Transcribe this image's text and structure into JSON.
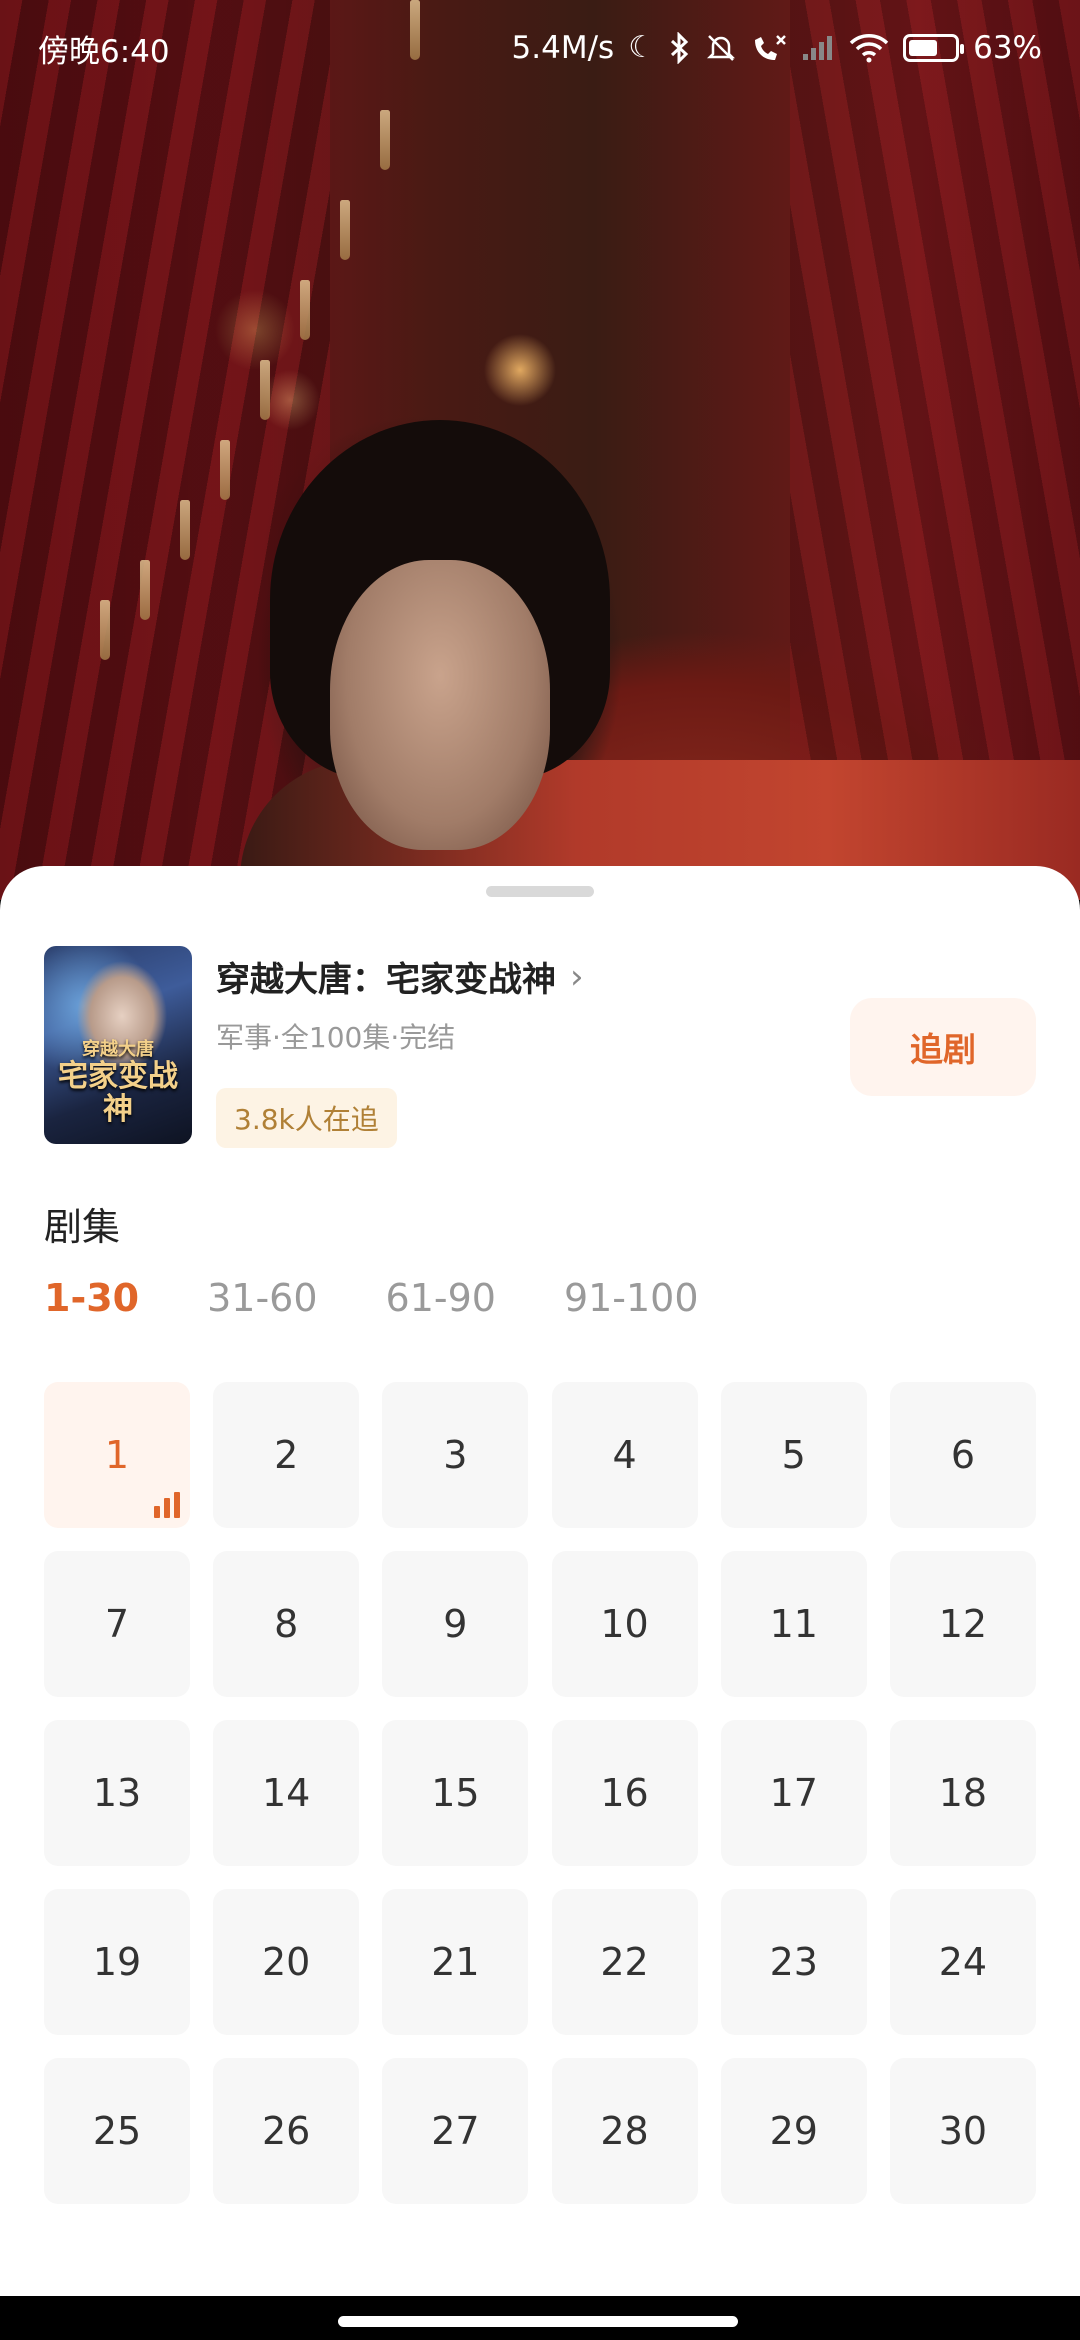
{
  "status_bar": {
    "time": "傍晚6:40",
    "net_speed": "5.4M/s",
    "battery_pct": "63%",
    "battery_level": 0.63,
    "icons": [
      "moon-icon",
      "bluetooth-icon",
      "bell-muted-icon",
      "call-missed-icon",
      "signal-icon",
      "wifi-icon",
      "battery-icon"
    ]
  },
  "drama": {
    "poster_text_line1": "穿越大唐",
    "poster_text_line2": "宅家变战神",
    "title": "穿越大唐：宅家变战神",
    "meta": "军事·全100集·完结",
    "followers": "3.8k人在追",
    "follow_button": "追剧"
  },
  "episodes": {
    "section_title": "剧集",
    "ranges": [
      "1-30",
      "31-60",
      "61-90",
      "91-100"
    ],
    "active_range_index": 0,
    "active_episode": 1,
    "list": [
      "1",
      "2",
      "3",
      "4",
      "5",
      "6",
      "7",
      "8",
      "9",
      "10",
      "11",
      "12",
      "13",
      "14",
      "15",
      "16",
      "17",
      "18",
      "19",
      "20",
      "21",
      "22",
      "23",
      "24",
      "25",
      "26",
      "27",
      "28",
      "29",
      "30"
    ]
  },
  "colors": {
    "accent": "#e0662a",
    "badge_bg": "#fdf3e4",
    "badge_text": "#b08036",
    "tile_bg": "#f7f7f7"
  }
}
